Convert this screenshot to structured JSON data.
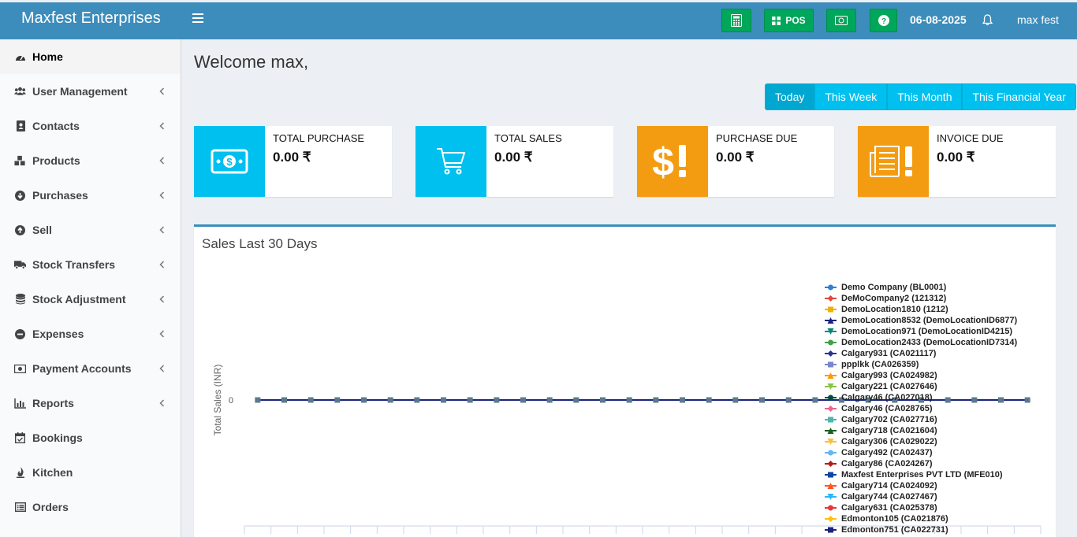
{
  "header": {
    "brand": "Maxfest Enterprises",
    "pos_label": "POS",
    "date": "06-08-2025",
    "user": "max fest",
    "color": "#3c8dbc",
    "button_color": "#00a65a"
  },
  "sidebar": {
    "items": [
      {
        "label": "Home",
        "icon": "dashboard-icon",
        "active": true
      },
      {
        "label": "User Management",
        "icon": "users-icon"
      },
      {
        "label": "Contacts",
        "icon": "address-book-icon"
      },
      {
        "label": "Products",
        "icon": "cubes-icon"
      },
      {
        "label": "Purchases",
        "icon": "arrow-circle-down-icon"
      },
      {
        "label": "Sell",
        "icon": "arrow-circle-up-icon"
      },
      {
        "label": "Stock Transfers",
        "icon": "truck-icon"
      },
      {
        "label": "Stock Adjustment",
        "icon": "database-icon"
      },
      {
        "label": "Expenses",
        "icon": "minus-circle-icon"
      },
      {
        "label": "Payment Accounts",
        "icon": "money-icon"
      },
      {
        "label": "Reports",
        "icon": "bar-chart-icon"
      },
      {
        "label": "Bookings",
        "icon": "calendar-check-icon"
      },
      {
        "label": "Kitchen",
        "icon": "fire-icon"
      },
      {
        "label": "Orders",
        "icon": "list-icon"
      }
    ]
  },
  "main": {
    "welcome": "Welcome max,",
    "period_buttons": [
      "Today",
      "This Week",
      "This Month",
      "This Financial Year"
    ],
    "period_selected": "Today",
    "info_boxes": [
      {
        "label": "TOTAL PURCHASE",
        "value": "0.00 ₹",
        "color": "#00c0ef",
        "icon": "money-bill-icon"
      },
      {
        "label": "TOTAL SALES",
        "value": "0.00 ₹",
        "color": "#00c0ef",
        "icon": "shopping-cart-icon"
      },
      {
        "label": "PURCHASE DUE",
        "value": "0.00 ₹",
        "color": "#f39c12",
        "icon": "dollar-exclamation-icon"
      },
      {
        "label": "INVOICE DUE",
        "value": "0.00 ₹",
        "color": "#f39c12",
        "icon": "document-exclamation-icon"
      }
    ]
  },
  "chart_panel": {
    "title": "Sales Last 30 Days",
    "chart_data": {
      "type": "line",
      "ylabel": "Total Sales (INR)",
      "y_ticks": [
        "0"
      ],
      "num_points": 30,
      "grid": false,
      "legend_position": "right",
      "series": [
        {
          "name": "Demo Company (BL0001)",
          "color": "#2f7ed8",
          "marker": "circle"
        },
        {
          "name": "DeMoCompany2 (121312)",
          "color": "#e8463a",
          "marker": "diamond"
        },
        {
          "name": "DemoLocation1810 (1212)",
          "color": "#f0b000",
          "marker": "square"
        },
        {
          "name": "DemoLocation8532 (DemoLocationID6877)",
          "color": "#1a237e",
          "marker": "triangle"
        },
        {
          "name": "DemoLocation971 (DemoLocationID4215)",
          "color": "#00897b",
          "marker": "triangle-down"
        },
        {
          "name": "DemoLocation2433 (DemoLocationID7314)",
          "color": "#43a047",
          "marker": "circle"
        },
        {
          "name": "Calgary931 (CA021117)",
          "color": "#283593",
          "marker": "diamond"
        },
        {
          "name": "ppplkk (CA026359)",
          "color": "#7986cb",
          "marker": "square"
        },
        {
          "name": "Calgary993 (CA024982)",
          "color": "#ff9800",
          "marker": "triangle"
        },
        {
          "name": "Calgary221 (CA027646)",
          "color": "#8bc34a",
          "marker": "triangle-down"
        },
        {
          "name": "Calgary46 (CA027018)",
          "color": "#004d40",
          "marker": "circle"
        },
        {
          "name": "Calgary46 (CA028765)",
          "color": "#f06292",
          "marker": "diamond"
        },
        {
          "name": "Calgary702 (CA027716)",
          "color": "#4db6ac",
          "marker": "square"
        },
        {
          "name": "Calgary718 (CA021604)",
          "color": "#1b5e20",
          "marker": "triangle"
        },
        {
          "name": "Calgary306 (CA029022)",
          "color": "#fbc02d",
          "marker": "triangle-down"
        },
        {
          "name": "Calgary492 (CA02437)",
          "color": "#64b5f6",
          "marker": "circle"
        },
        {
          "name": "Calgary86 (CA024267)",
          "color": "#b71c1c",
          "marker": "diamond"
        },
        {
          "name": "Maxfest Enterprises PVT LTD (MFE010)",
          "color": "#0d47a1",
          "marker": "square"
        },
        {
          "name": "Calgary714 (CA024092)",
          "color": "#ff5722",
          "marker": "triangle"
        },
        {
          "name": "Calgary744 (CA027467)",
          "color": "#29b6f6",
          "marker": "triangle-down"
        },
        {
          "name": "Calgary631 (CA025378)",
          "color": "#e53935",
          "marker": "circle"
        },
        {
          "name": "Edmonton105 (CA021876)",
          "color": "#ffc107",
          "marker": "diamond"
        },
        {
          "name": "Edmonton751 (CA022731)",
          "color": "#1a237e",
          "marker": "square"
        }
      ]
    }
  }
}
